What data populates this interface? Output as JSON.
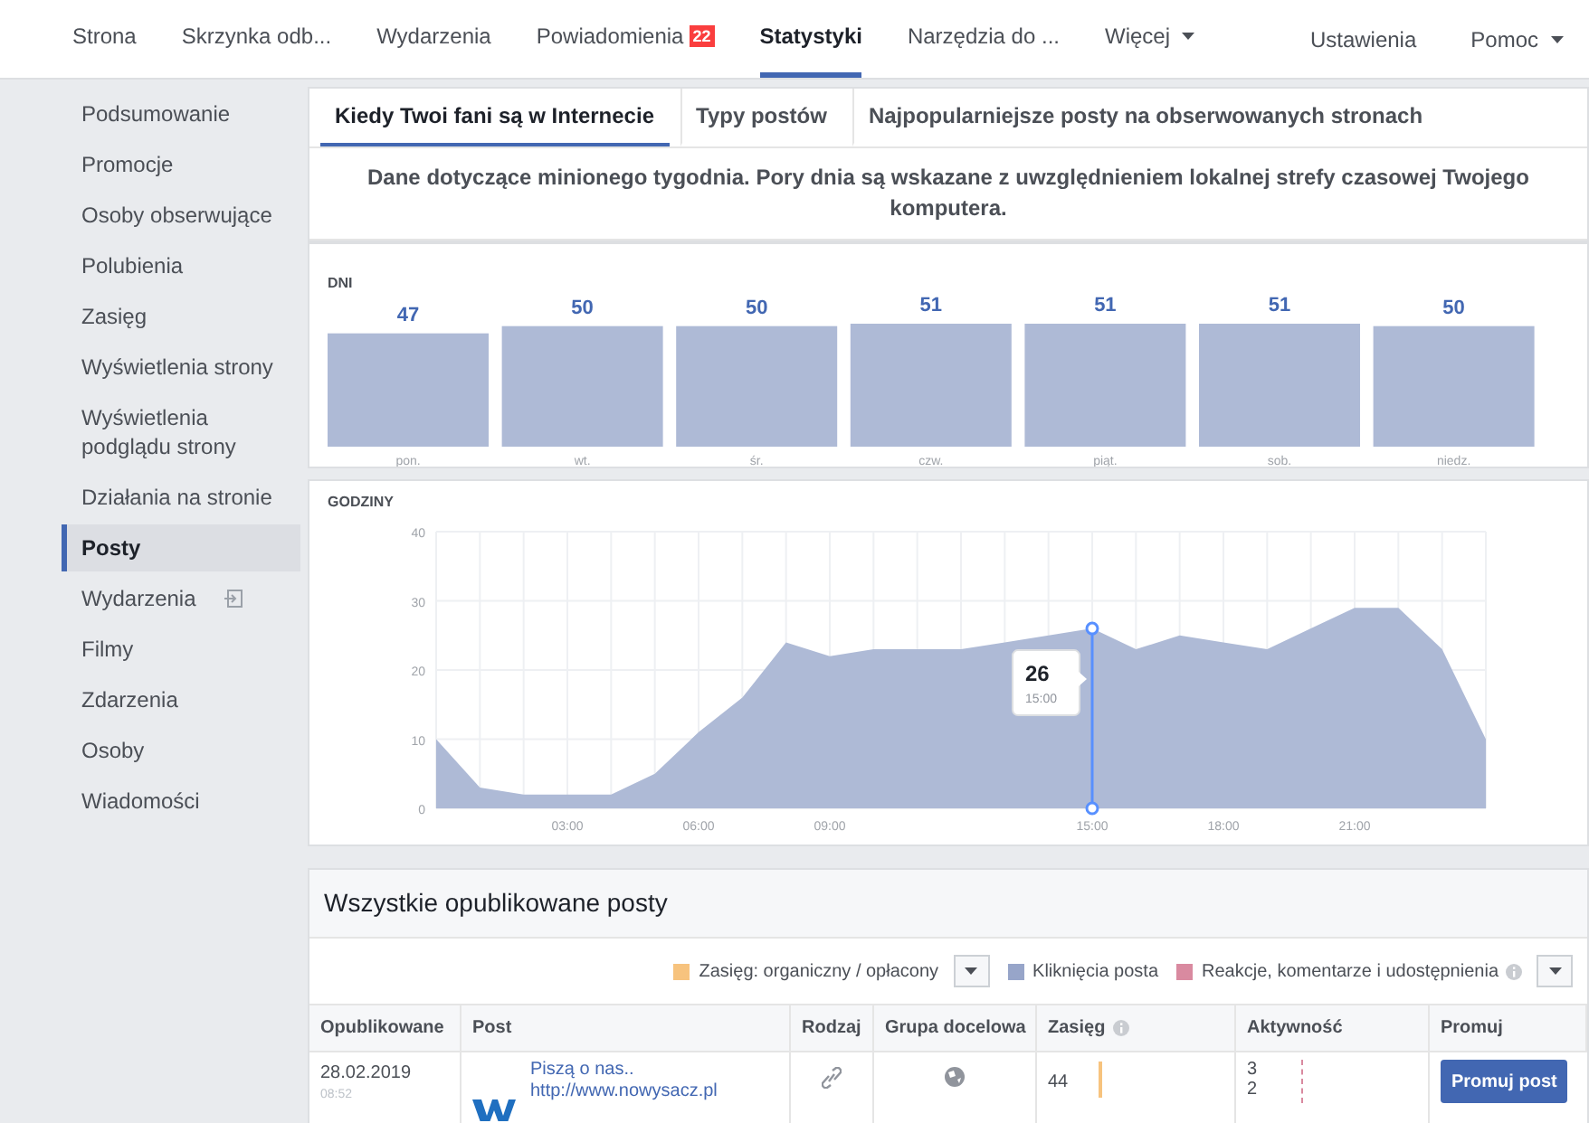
{
  "nav": {
    "items": [
      {
        "label": "Strona",
        "selected": false
      },
      {
        "label": "Skrzynka odb...",
        "selected": false
      },
      {
        "label": "Wydarzenia",
        "selected": false
      },
      {
        "label": "Powiadomienia",
        "selected": false,
        "badge": "22"
      },
      {
        "label": "Statystyki",
        "selected": true
      },
      {
        "label": "Narzędzia do ...",
        "selected": false
      },
      {
        "label": "Więcej",
        "selected": false,
        "dropdown": true
      }
    ],
    "right": [
      {
        "label": "Ustawienia",
        "dropdown": false
      },
      {
        "label": "Pomoc",
        "dropdown": true
      }
    ]
  },
  "sidebar": {
    "items": [
      {
        "label": "Podsumowanie",
        "selected": false
      },
      {
        "label": "Promocje",
        "selected": false
      },
      {
        "label": "Osoby obserwujące",
        "selected": false
      },
      {
        "label": "Polubienia",
        "selected": false
      },
      {
        "label": "Zasięg",
        "selected": false
      },
      {
        "label": "Wyświetlenia strony",
        "selected": false
      },
      {
        "label": "Wyświetlenia podglądu strony",
        "selected": false
      },
      {
        "label": "Działania na stronie",
        "selected": false
      },
      {
        "label": "Posty",
        "selected": true
      },
      {
        "label": "Wydarzenia",
        "selected": false,
        "has_icon": true
      },
      {
        "label": "Filmy",
        "selected": false
      },
      {
        "label": "Zdarzenia",
        "selected": false
      },
      {
        "label": "Osoby",
        "selected": false
      },
      {
        "label": "Wiadomości",
        "selected": false
      }
    ]
  },
  "subtabs": [
    {
      "label": "Kiedy Twoi fani są w Internecie",
      "selected": true
    },
    {
      "label": "Typy postów",
      "selected": false
    },
    {
      "label": "Najpopularniejsze posty na obserwowanych stronach",
      "selected": false
    }
  ],
  "note": "Dane dotyczące minionego tygodnia. Pory dnia są wskazane z uwzględnieniem lokalnej strefy czasowej Twojego komputera.",
  "days": {
    "title": "DNI",
    "chart_data": {
      "type": "bar",
      "categories": [
        "pon.",
        "wt.",
        "śr.",
        "czw.",
        "piąt.",
        "sob.",
        "niedz."
      ],
      "series": [
        {
          "color": "#aebad6",
          "values": [
            47,
            50,
            50,
            51,
            51,
            51,
            50
          ]
        }
      ],
      "data_labels": true
    }
  },
  "hours": {
    "title": "GODZINY",
    "chart_data": {
      "type": "area",
      "x": [
        0,
        1,
        2,
        3,
        4,
        5,
        6,
        7,
        8,
        9,
        10,
        11,
        12,
        13,
        14,
        15,
        16,
        17,
        18,
        19,
        20,
        21,
        22,
        23,
        24
      ],
      "grid": true,
      "series": [
        {
          "color": "#aebad6",
          "values": [
            10,
            3,
            2,
            2,
            2,
            5,
            11,
            16,
            24,
            22,
            23,
            23,
            23,
            24,
            25,
            26,
            23,
            25,
            24,
            23,
            26,
            29,
            29,
            23,
            10
          ]
        }
      ],
      "ylim": [
        0,
        40
      ],
      "yticks": [
        0,
        10,
        20,
        30,
        40
      ],
      "xlim": [
        0,
        24
      ],
      "xticks": [
        {
          "value": 3,
          "label": "03:00"
        },
        {
          "value": 6,
          "label": "06:00"
        },
        {
          "value": 9,
          "label": "09:00"
        },
        {
          "value": 15,
          "label": "15:00"
        },
        {
          "value": 18,
          "label": "18:00"
        },
        {
          "value": 21,
          "label": "21:00"
        }
      ],
      "annotations": [
        {
          "x": 15,
          "y": 26,
          "text": "26"
        }
      ]
    },
    "tooltip_time": "15:00"
  },
  "posts": {
    "title": "Wszystkie opublikowane posty",
    "legend": [
      {
        "kind": "legend",
        "label": "Zasięg: organiczny / opłacony",
        "color": "#f7c37e"
      },
      {
        "kind": "dropdown"
      },
      {
        "kind": "legend",
        "label": "Kliknięcia posta",
        "color": "#97a5c9"
      },
      {
        "kind": "legend",
        "label": "Reakcje, komentarze i udostępnienia",
        "color": "#d98aa0"
      },
      {
        "kind": "info"
      },
      {
        "kind": "dropdown"
      }
    ],
    "columns": [
      {
        "kind": "plain",
        "label": "Opublikowane"
      },
      {
        "kind": "plain",
        "label": "Post"
      },
      {
        "kind": "plain",
        "label": "Rodzaj"
      },
      {
        "kind": "plain",
        "label": "Grupa docelowa"
      },
      {
        "kind": "info",
        "label": "Zasięg"
      },
      {
        "kind": "plain",
        "label": "Aktywność"
      },
      {
        "kind": "plain",
        "label": "Promuj"
      }
    ],
    "rows": [
      {
        "date": "28.02.2019",
        "time": "08:52",
        "title": "Piszą o nas..",
        "link": "http://www.nowysacz.pl",
        "reach": "44",
        "activity": [
          "3",
          "2"
        ],
        "button": "Promuj post"
      }
    ]
  }
}
